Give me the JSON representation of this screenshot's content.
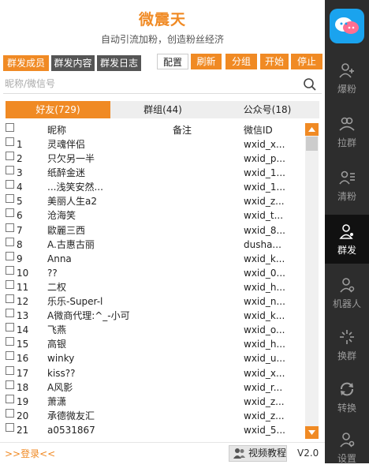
{
  "app": {
    "title": "微震天",
    "subtitle": "自动引流加粉，创造粉丝经济"
  },
  "section_tabs": [
    {
      "label": "群发成员",
      "active": true
    },
    {
      "label": "群发内容",
      "active": false
    },
    {
      "label": "群发日志",
      "active": false
    }
  ],
  "toolbar": {
    "config": "配置",
    "refresh": "刷新",
    "group": "分组",
    "start": "开始",
    "stop": "停止"
  },
  "search": {
    "placeholder": "昵称/微信号",
    "value": ""
  },
  "category_tabs": [
    {
      "label": "好友(729)",
      "active": true
    },
    {
      "label": "群组(44)",
      "active": false
    },
    {
      "label": "公众号(18)",
      "active": false
    }
  ],
  "table": {
    "headers": {
      "nick": "昵称",
      "note": "备注",
      "wxid": "微信ID"
    },
    "rows": [
      {
        "no": "1",
        "nick": "灵魂伴侣",
        "note": "",
        "wxid": "wxid_x..."
      },
      {
        "no": "2",
        "nick": "只欠另一半",
        "note": "",
        "wxid": "wxid_p..."
      },
      {
        "no": "3",
        "nick": "纸醉金迷",
        "note": "",
        "wxid": "wxid_1..."
      },
      {
        "no": "4",
        "nick": "...浅笑安然...",
        "note": "",
        "wxid": "wxid_1..."
      },
      {
        "no": "5",
        "nick": "美丽人生a2",
        "note": "",
        "wxid": "wxid_z..."
      },
      {
        "no": "6",
        "nick": "沧海笑",
        "note": "",
        "wxid": "wxid_t..."
      },
      {
        "no": "7",
        "nick": "歐麗三西",
        "note": "",
        "wxid": "wxid_8..."
      },
      {
        "no": "8",
        "nick": "A.古惠古丽",
        "note": "",
        "wxid": "dusha..."
      },
      {
        "no": "9",
        "nick": "Anna",
        "note": "",
        "wxid": "wxid_k..."
      },
      {
        "no": "10",
        "nick": "??",
        "note": "",
        "wxid": "wxid_0..."
      },
      {
        "no": "11",
        "nick": "二权",
        "note": "",
        "wxid": "wxid_h..."
      },
      {
        "no": "12",
        "nick": "乐乐-Super-l",
        "note": "",
        "wxid": "wxid_n..."
      },
      {
        "no": "13",
        "nick": "A微商代理:^_-小可",
        "note": "",
        "wxid": "wxid_k..."
      },
      {
        "no": "14",
        "nick": "飞燕",
        "note": "",
        "wxid": "wxid_o..."
      },
      {
        "no": "15",
        "nick": "高银",
        "note": "",
        "wxid": "wxid_h..."
      },
      {
        "no": "16",
        "nick": "winky",
        "note": "",
        "wxid": "wxid_u..."
      },
      {
        "no": "17",
        "nick": "kiss??",
        "note": "",
        "wxid": "wxid_x..."
      },
      {
        "no": "18",
        "nick": "A风影",
        "note": "",
        "wxid": "wxid_r..."
      },
      {
        "no": "19",
        "nick": "萧潇",
        "note": "",
        "wxid": "wxid_z..."
      },
      {
        "no": "20",
        "nick": "承德微友汇",
        "note": "",
        "wxid": "wxid_z..."
      },
      {
        "no": "21",
        "nick": "a0531867",
        "note": "",
        "wxid": "wxid_5..."
      }
    ]
  },
  "footer": {
    "login": ">>登录<<",
    "video": "视频教程",
    "version": "V2.0"
  },
  "sidebar": {
    "logo_icon": "chat-bubbles-logo-icon",
    "items": [
      {
        "label": "爆粉",
        "icon": "user-plus-icon",
        "active": false
      },
      {
        "label": "拉群",
        "icon": "users-icon",
        "active": false
      },
      {
        "label": "清粉",
        "icon": "user-list-icon",
        "active": false
      },
      {
        "label": "群发",
        "icon": "user-broadcast-icon",
        "active": true
      },
      {
        "label": "机器人",
        "icon": "robot-user-icon",
        "active": false
      },
      {
        "label": "换群",
        "icon": "sparkle-icon",
        "active": false
      },
      {
        "label": "转换",
        "icon": "refresh-icon",
        "active": false
      },
      {
        "label": "设置",
        "icon": "settings-user-icon",
        "active": false
      }
    ]
  },
  "colors": {
    "accent": "#f08a24",
    "sidebar_bg": "#2d2d2d",
    "logo_bg": "#1aa3ee"
  }
}
